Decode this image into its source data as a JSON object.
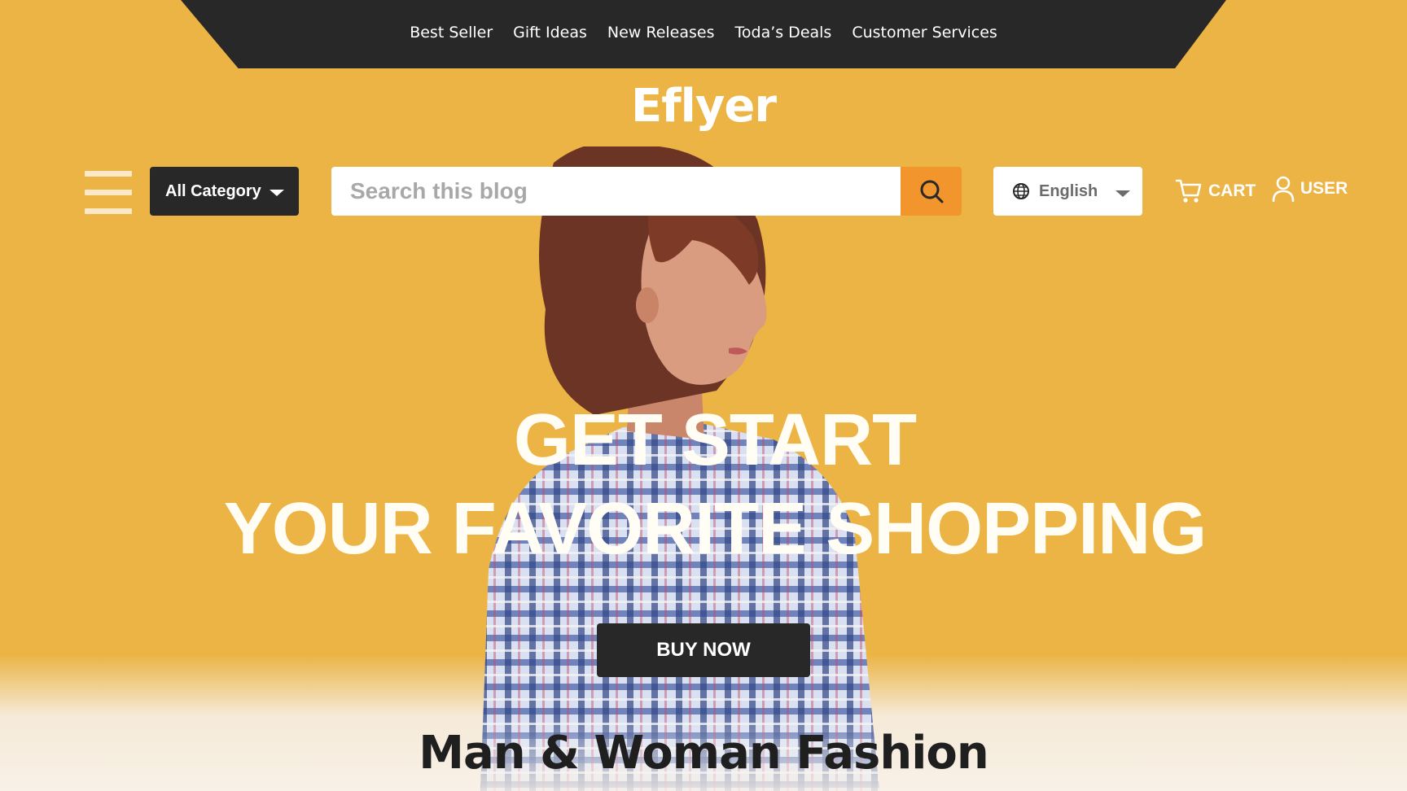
{
  "nav": {
    "links": [
      "Best Seller",
      "Gift Ideas",
      "New Releases",
      "Toda’s Deals",
      "Customer Services"
    ]
  },
  "brand": {
    "name": "Eflyer"
  },
  "toolbar": {
    "category_label": "All Category",
    "search_placeholder": "Search this blog",
    "language": "English",
    "cart_label": "CART",
    "user_label": "USER"
  },
  "hero": {
    "line1": "GET START",
    "line2": "YOUR FAVORITE SHOPPING",
    "cta_label": "BUY NOW"
  },
  "section": {
    "title": "Man & Woman Fashion"
  },
  "colors": {
    "background": "#ebb445",
    "dark": "#282828",
    "search_button": "#f1952c",
    "section_bg": "#f8f1e7"
  },
  "icons": [
    "hamburger-icon",
    "chevron-down-icon",
    "search-icon",
    "globe-icon",
    "cart-icon",
    "user-icon"
  ]
}
